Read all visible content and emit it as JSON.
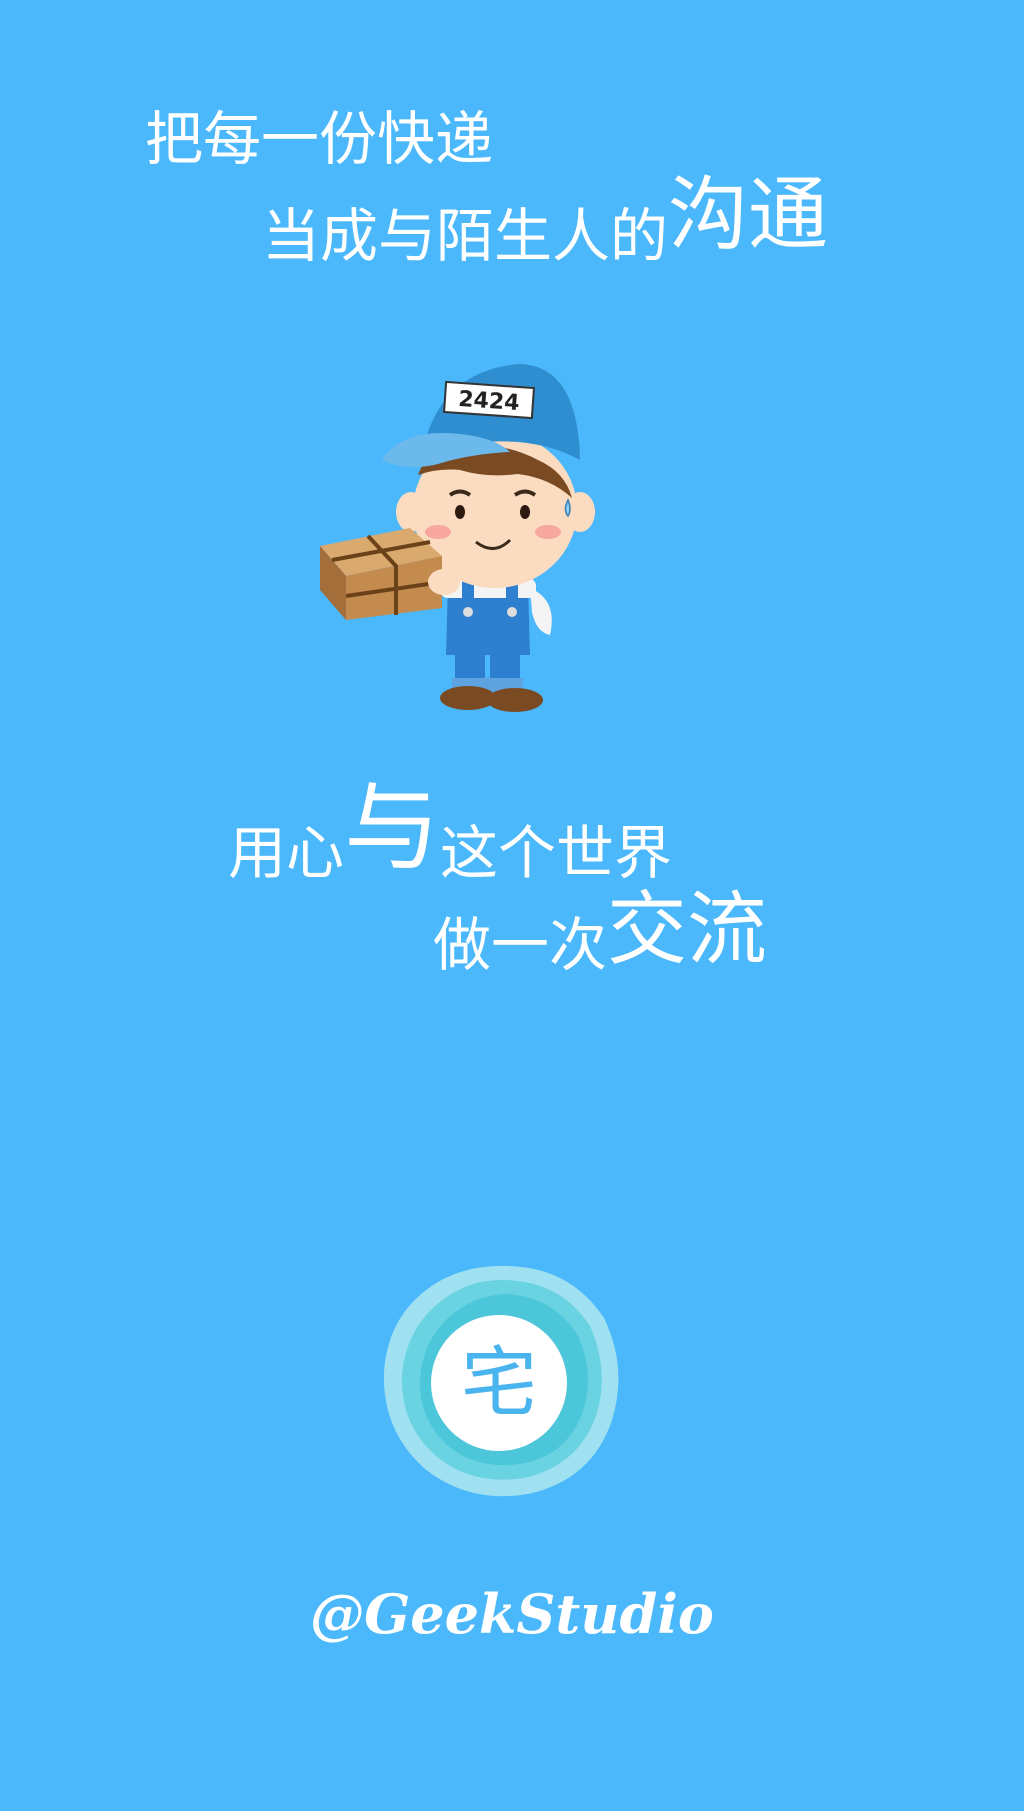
{
  "slogan": {
    "line1": "把每一份快递",
    "line2_a": "当成与陌生人的",
    "line2_b": "沟通",
    "line3_a": "用心",
    "line3_b": "与",
    "line3_c": "这个世界",
    "line4_a": "做一次",
    "line4_b": "交流"
  },
  "illustration": {
    "cap_number": "2424",
    "icon": "courier-with-package-icon"
  },
  "logo": {
    "glyph": "宅",
    "icon": "app-logo-icon"
  },
  "signature": "@GeekStudio",
  "colors": {
    "background": "#4bb8fb",
    "text": "#ffffff",
    "logo_glyph": "#49b4ee",
    "logo_ring": "#8ddde9"
  }
}
